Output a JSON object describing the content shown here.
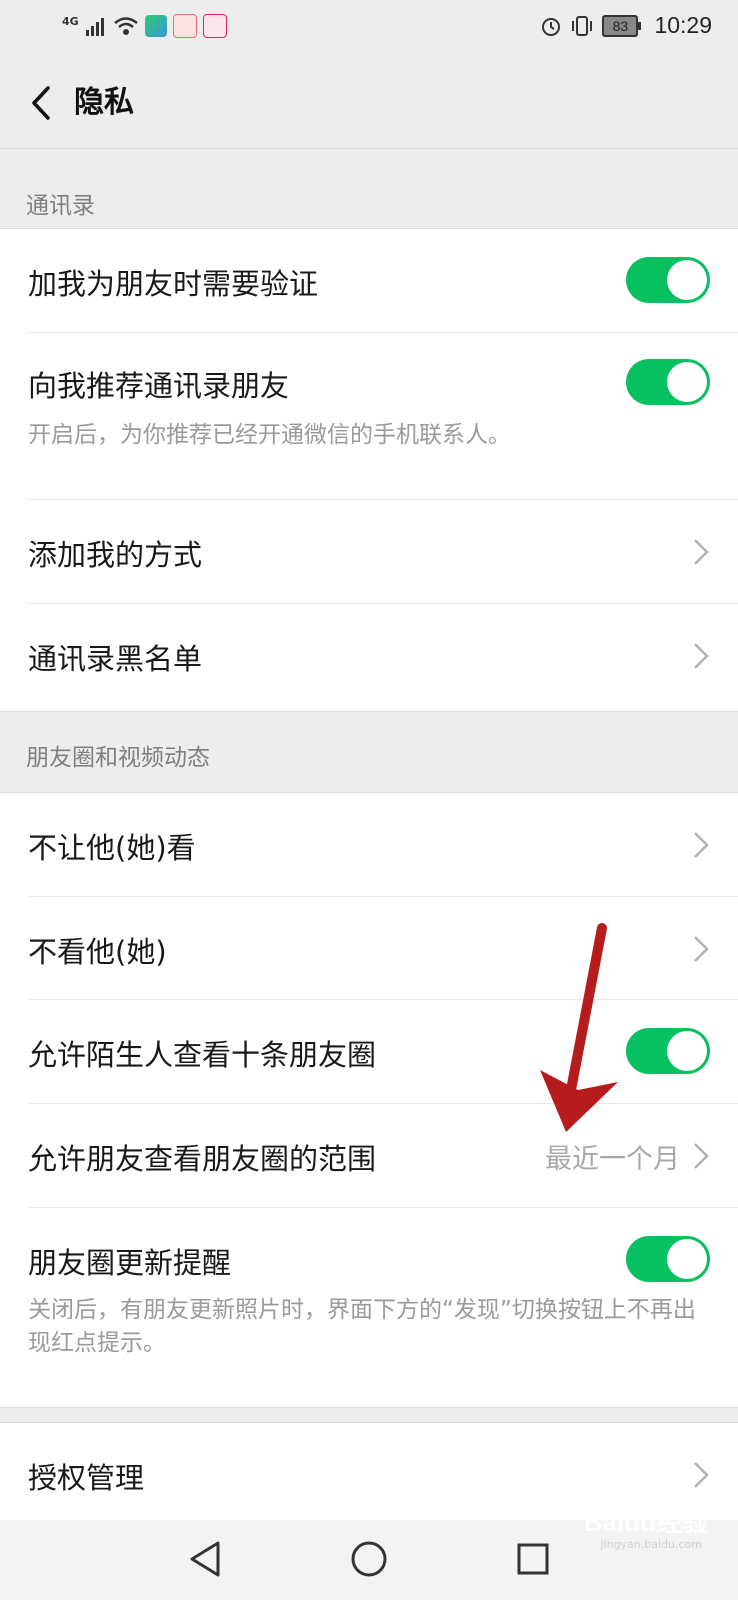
{
  "status_bar": {
    "network": "4G",
    "battery": "83",
    "time": "10:29"
  },
  "header": {
    "title": "隐私"
  },
  "sections": {
    "contacts": {
      "title": "通讯录",
      "require_verification": {
        "label": "加我为朋友时需要验证",
        "enabled": true
      },
      "recommend_contacts": {
        "label": "向我推荐通讯录朋友",
        "desc": "开启后，为你推荐已经开通微信的手机联系人。",
        "enabled": true
      },
      "add_methods": {
        "label": "添加我的方式"
      },
      "blacklist": {
        "label": "通讯录黑名单"
      }
    },
    "moments": {
      "title": "朋友圈和视频动态",
      "hide_from": {
        "label": "不让他(她)看"
      },
      "hide_theirs": {
        "label": "不看他(她)"
      },
      "stranger_view": {
        "label": "允许陌生人查看十条朋友圈",
        "enabled": true
      },
      "visible_range": {
        "label": "允许朋友查看朋友圈的范围",
        "value": "最近一个月"
      },
      "update_reminder": {
        "label": "朋友圈更新提醒",
        "desc": "关闭后，有朋友更新照片时，界面下方的“发现”切换按钮上不再出现红点提示。",
        "enabled": true
      }
    },
    "authorization": {
      "manage": {
        "label": "授权管理"
      }
    }
  },
  "watermark": "Baidu经验",
  "watermark_url": "jingyan.baidu.com",
  "colors": {
    "accent": "#07c160",
    "annotation_arrow": "#b71c1c"
  }
}
